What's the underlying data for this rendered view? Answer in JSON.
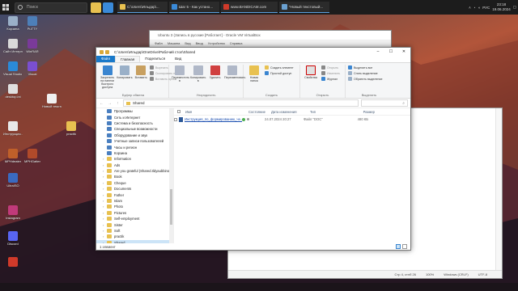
{
  "desktop": {
    "icons": [
      {
        "label": "Корзина",
        "color": "#9ab0c8"
      },
      {
        "label": "PuTTY",
        "color": "#4d7fb8"
      },
      {
        "label": "Сайт Интернет-Предприн...",
        "color": "#d9d9d9"
      },
      {
        "label": "WinRAR",
        "color": "#7a3a9a"
      },
      {
        "label": "Visual Studio Code",
        "color": "#2a8ad8"
      },
      {
        "label": "Visual",
        "color": "#7a4fd0"
      },
      {
        "label": "desktop.ini",
        "color": "#e0e0e0"
      },
      {
        "label": "Новый текстов...",
        "color": "#f0f0f0"
      },
      {
        "label": "Инструкция...",
        "color": "#e8e8e8"
      },
      {
        "label": "practik",
        "color": "#e8c150"
      },
      {
        "label": "MPHdeater",
        "color": "#c0602a"
      },
      {
        "label": "MPHGatter",
        "color": "#b04a2a"
      },
      {
        "label": "UltraISO",
        "color": "#3a6ac0"
      },
      {
        "label": "Instagram",
        "color": "#c03a7a"
      },
      {
        "label": "Discord",
        "color": "#5865f2"
      },
      {
        "label": "",
        "color": "#d03a2a"
      }
    ]
  },
  "topbar": {
    "search_placeholder": "Поиск",
    "tasks": [
      {
        "label": "C:\\Users\\Ильдар\\...",
        "color": "#e8c150"
      },
      {
        "label": "Шаг 5 - Как устано...",
        "color": "#3a8ad8"
      },
      {
        "label": "www.BANDICAM.com",
        "color": "#d03a2a"
      },
      {
        "label": "*Новый текстовый...",
        "color": "#6aa0d0"
      }
    ],
    "tray": {
      "lang": "РУС",
      "time": "23:18",
      "date": "19.06.2024"
    }
  },
  "vbox": {
    "title": "Ubuntu 3 (Запись в русские [Работает] - Oracle VM VirtualBox",
    "menu": [
      "Файл",
      "Машина",
      "Вид",
      "Ввод",
      "Устройства",
      "Справка"
    ]
  },
  "notepad": {
    "status": {
      "pos": "Стр 4, стлб 26",
      "zoom": "100%",
      "eol": "Windows (CRLF)",
      "enc": "UTF-8"
    }
  },
  "explorer": {
    "title": "C:\\Users\\Ильдар\\OneDrive\\Рабочий стол\\Shared",
    "tabs": [
      "Файл",
      "Главная",
      "Поделиться",
      "Вид"
    ],
    "ribbon": {
      "clipboard": {
        "big": [
          "Закрепить на панели быстрого доступа",
          "Копировать",
          "Вставить"
        ],
        "small": [
          "Вырезать",
          "Скопировать путь",
          "Вставить ярлык"
        ],
        "label": "Буфер обмена"
      },
      "organize": {
        "big": [
          "Переместить в",
          "Копировать в",
          "Удалить",
          "Переименовать"
        ],
        "label": "Упорядочить"
      },
      "create": {
        "big": [
          "Новая папка"
        ],
        "small": [
          "Создать элемент",
          "Простой доступ"
        ],
        "label": "Создать"
      },
      "open": {
        "big": [
          "Свойства"
        ],
        "small": [
          "Открыть",
          "Изменить",
          "Журнал"
        ],
        "label": "Открыть"
      },
      "select": {
        "small": [
          "Выделить все",
          "Снять выделение",
          "Обратить выделение"
        ],
        "label": "Выделить"
      }
    },
    "address": "Shared",
    "nav": [
      {
        "label": "Программы",
        "kind": "sys"
      },
      {
        "label": "Сеть и Интернет",
        "kind": "sys"
      },
      {
        "label": "Система и безопасность",
        "kind": "sys"
      },
      {
        "label": "Специальные возможности",
        "kind": "sys"
      },
      {
        "label": "Оборудование и звук",
        "kind": "sys"
      },
      {
        "label": "Учетные записи пользователей",
        "kind": "sys"
      },
      {
        "label": "Часы и регион",
        "kind": "sys"
      },
      {
        "label": "Корзина",
        "kind": "sys"
      },
      {
        "label": "Information",
        "kind": "folder"
      },
      {
        "label": "Ads",
        "kind": "folder"
      },
      {
        "label": "Are you grateful (Shared.Ildyaubbino)",
        "kind": "folder"
      },
      {
        "label": "Book",
        "kind": "folder"
      },
      {
        "label": "Cheque",
        "kind": "folder"
      },
      {
        "label": "Documents",
        "kind": "folder"
      },
      {
        "label": "Father",
        "kind": "folder"
      },
      {
        "label": "Islam",
        "kind": "folder"
      },
      {
        "label": "Photo",
        "kind": "folder"
      },
      {
        "label": "Pictures",
        "kind": "folder"
      },
      {
        "label": "Self-employment",
        "kind": "folder"
      },
      {
        "label": "Sister",
        "kind": "folder"
      },
      {
        "label": "Soft",
        "kind": "folder"
      },
      {
        "label": "practik",
        "kind": "folder"
      },
      {
        "label": "Shared",
        "kind": "folder",
        "selected": true
      },
      {
        "label": "Рабочие задачи",
        "kind": "folder"
      }
    ],
    "columns": {
      "name": "Имя",
      "status": "Состояние",
      "date": "Дата изменения",
      "type": "Тип",
      "size": "Размер"
    },
    "files": [
      {
        "name": "Инструкция_по_формированию_че...",
        "date": "24.07.2024 20:27",
        "type": "Файл \"DOC\"",
        "size": "480 КБ"
      }
    ],
    "status_text": "1 элемент"
  }
}
